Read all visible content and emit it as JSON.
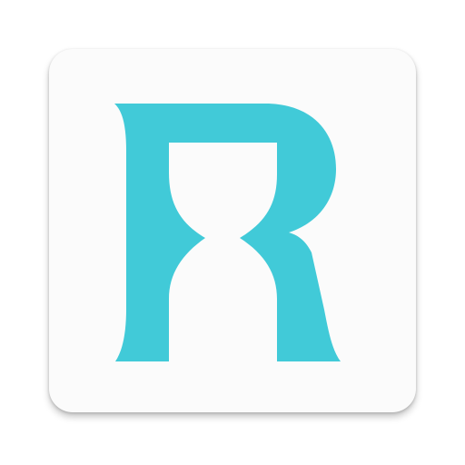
{
  "app_icon": {
    "name": "R logo",
    "glyph": "R",
    "colors": {
      "background": "#ffffff",
      "tile": "#fbfbfb",
      "logo": "#41cad8"
    }
  }
}
